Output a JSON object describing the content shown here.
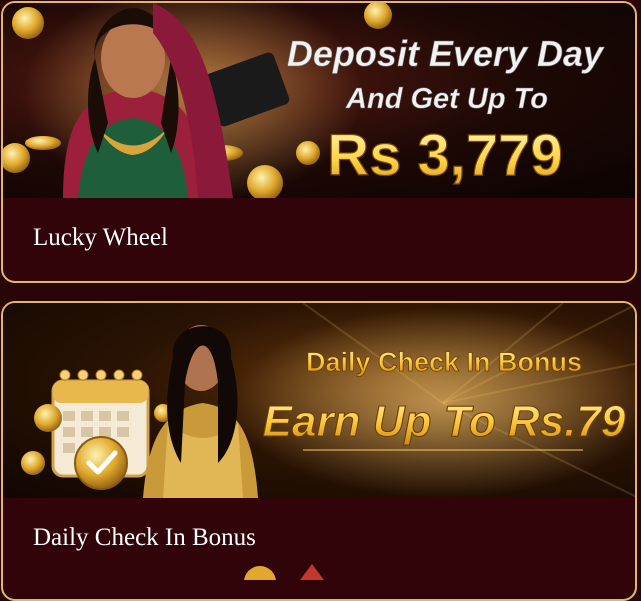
{
  "promos": [
    {
      "caption": "Lucky Wheel",
      "banner": {
        "line1": "Deposit Every Day",
        "line2": "And Get Up To",
        "amount": "Rs 3,779"
      }
    },
    {
      "caption": "Daily Check In Bonus",
      "banner": {
        "line1": "Daily Check In Bonus",
        "line2": "Earn Up To Rs.79"
      }
    }
  ],
  "colors": {
    "card_border": "#e2b867",
    "card_bg": "#300409",
    "headline_white": "#f2f2f2",
    "headline_gold": "#ffd54a"
  }
}
